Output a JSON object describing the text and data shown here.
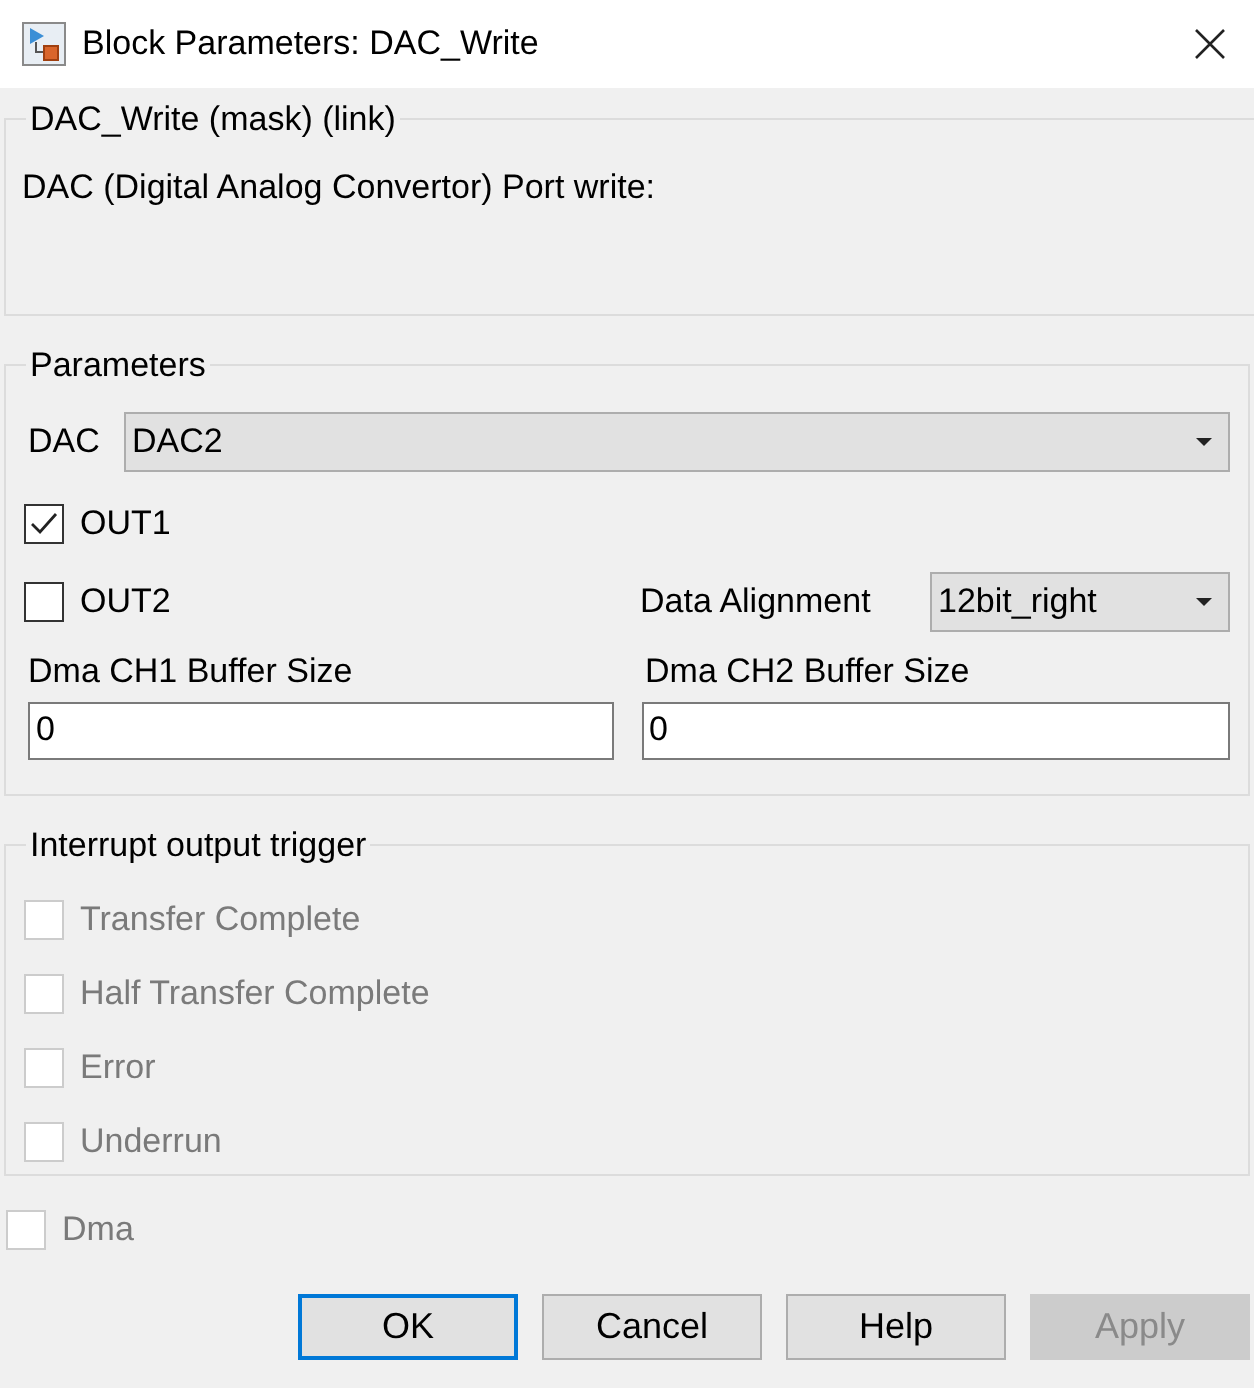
{
  "window": {
    "title": "Block Parameters: DAC_Write"
  },
  "description_group": {
    "title": "DAC_Write (mask) (link)",
    "text": "DAC (Digital Analog Convertor) Port write:"
  },
  "parameters": {
    "title": "Parameters",
    "dac": {
      "label": "DAC",
      "value": "DAC2"
    },
    "out1": {
      "label": "OUT1",
      "checked": true
    },
    "out2": {
      "label": "OUT2",
      "checked": false
    },
    "data_alignment": {
      "label": "Data Alignment",
      "value": "12bit_right"
    },
    "ch1_buffer": {
      "label": "Dma CH1 Buffer Size",
      "value": "0"
    },
    "ch2_buffer": {
      "label": "Dma CH2 Buffer Size",
      "value": "0"
    }
  },
  "interrupt_group": {
    "title": "Interrupt output trigger",
    "options": [
      {
        "label": "Transfer Complete",
        "checked": false,
        "disabled": true
      },
      {
        "label": "Half Transfer Complete",
        "checked": false,
        "disabled": true
      },
      {
        "label": "Error",
        "checked": false,
        "disabled": true
      },
      {
        "label": "Underrun",
        "checked": false,
        "disabled": true
      }
    ]
  },
  "dma": {
    "label": "Dma",
    "checked": false,
    "disabled": true
  },
  "buttons": [
    {
      "label": "OK",
      "default": true,
      "disabled": false
    },
    {
      "label": "Cancel",
      "default": false,
      "disabled": false
    },
    {
      "label": "Help",
      "default": false,
      "disabled": false
    },
    {
      "label": "Apply",
      "default": false,
      "disabled": true
    }
  ]
}
